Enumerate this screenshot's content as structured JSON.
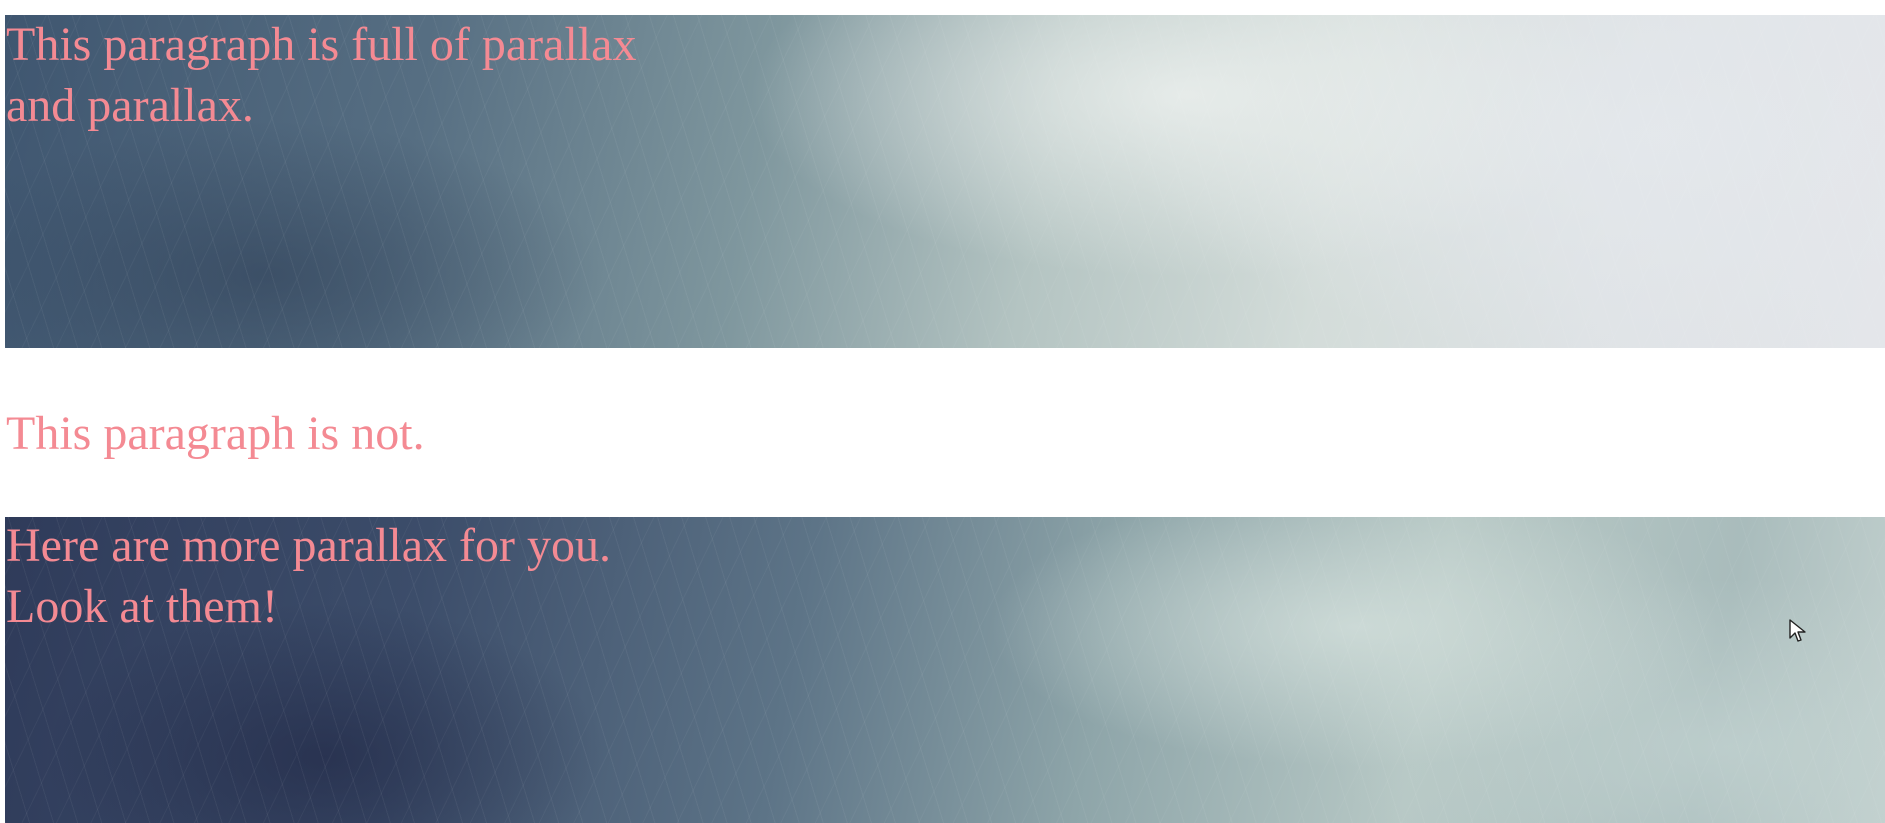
{
  "paragraphs": {
    "parallax_one": "This paragraph is full of parallax\nand parallax.",
    "plain": "This paragraph is not.",
    "parallax_two": "Here are more parallax for you.\nLook at them!"
  },
  "colors": {
    "text": "#f48a93",
    "page_background": "#ffffff"
  },
  "icons": {
    "cursor": "mouse-pointer-icon"
  }
}
